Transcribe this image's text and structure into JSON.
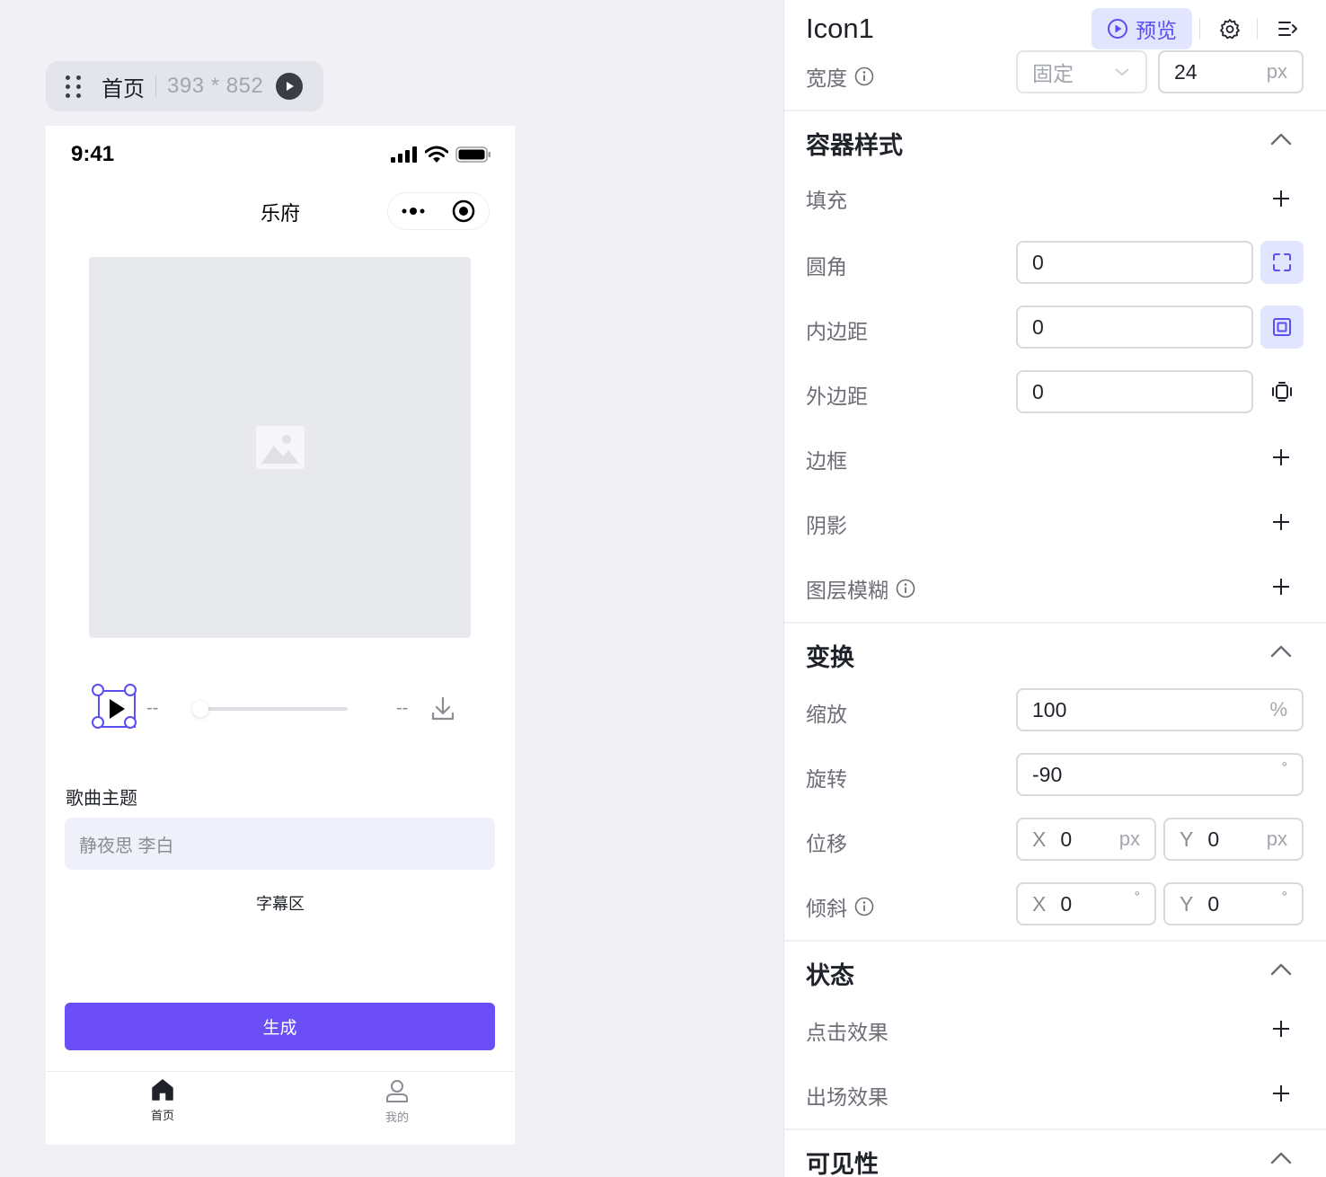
{
  "canvas": {
    "frame_name": "首页",
    "frame_size": "393 * 852"
  },
  "phone": {
    "status_time": "9:41",
    "nav_title": "乐府",
    "player": {
      "time_left": "--",
      "time_right": "--",
      "progress": 0
    },
    "field_label": "歌曲主题",
    "field_value": "静夜思 李白",
    "subtitle_area": "字幕区",
    "generate_label": "生成",
    "tabs": [
      {
        "label": "首页",
        "icon": "home-icon"
      },
      {
        "label": "我的",
        "icon": "user-icon"
      }
    ]
  },
  "colors": {
    "accent": "#6b4ef6",
    "selection": "#5b4ef5",
    "preview_bg": "#e2e5fe"
  },
  "panel": {
    "title": "Icon1",
    "preview_label": "预览",
    "width": {
      "label": "宽度",
      "mode": "固定",
      "value": "24",
      "unit": "px"
    },
    "container_style": {
      "title": "容器样式",
      "fill": "填充",
      "radius": {
        "label": "圆角",
        "value": "0"
      },
      "padding": {
        "label": "内边距",
        "value": "0"
      },
      "margin": {
        "label": "外边距",
        "value": "0"
      },
      "border": "边框",
      "shadow": "阴影",
      "layer_blur": "图层模糊"
    },
    "transform": {
      "title": "变换",
      "scale": {
        "label": "缩放",
        "value": "100",
        "unit": "%"
      },
      "rotate": {
        "label": "旋转",
        "value": "-90",
        "unit": "°"
      },
      "translate": {
        "label": "位移",
        "x_axis": "X",
        "x": "0",
        "y_axis": "Y",
        "y": "0",
        "unit": "px"
      },
      "skew": {
        "label": "倾斜",
        "x_axis": "X",
        "x": "0",
        "y_axis": "Y",
        "y": "0",
        "unit": "°"
      }
    },
    "state": {
      "title": "状态",
      "click_effect": "点击效果",
      "enter_effect": "出场效果"
    },
    "visibility": {
      "title": "可见性"
    }
  }
}
